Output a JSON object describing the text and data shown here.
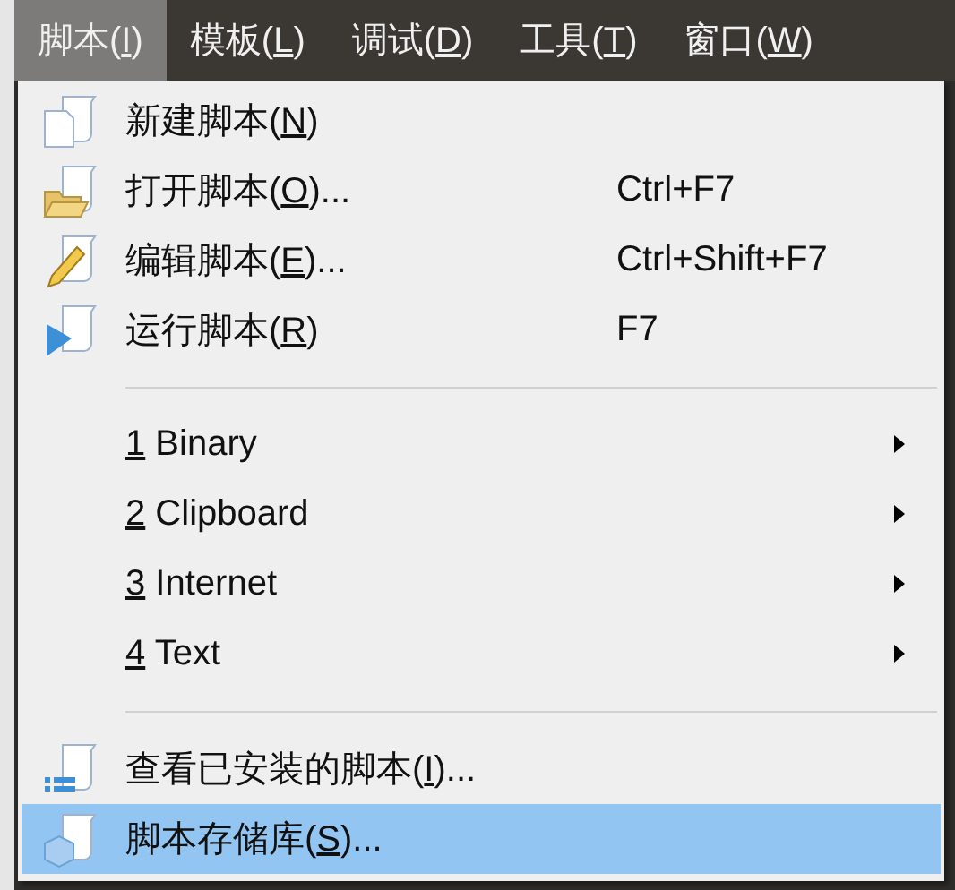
{
  "menubar": [
    {
      "before": "脚本(",
      "key": "I",
      "after": ")",
      "selected": true
    },
    {
      "before": "模板(",
      "key": "L",
      "after": ")",
      "selected": false
    },
    {
      "before": "调试(",
      "key": "D",
      "after": ")",
      "selected": false
    },
    {
      "before": "工具(",
      "key": "T",
      "after": ")",
      "selected": false
    },
    {
      "before": "窗口(",
      "key": "W",
      "after": ")",
      "selected": false
    }
  ],
  "menu": [
    {
      "kind": "command",
      "before": "新建脚本(",
      "key": "N",
      "after": ")",
      "selected": false
    },
    {
      "kind": "command",
      "before": "打开脚本(",
      "key": "O",
      "after": ")...",
      "shortcut": "Ctrl+F7",
      "selected": false
    },
    {
      "kind": "command",
      "before": "编辑脚本(",
      "key": "E",
      "after": ")...",
      "shortcut": "Ctrl+Shift+F7",
      "selected": false
    },
    {
      "kind": "command",
      "before": "运行脚本(",
      "key": "R",
      "after": ")",
      "shortcut": "F7",
      "selected": false
    },
    {
      "kind": "separator"
    },
    {
      "kind": "submenu",
      "key": "1",
      "after": " Binary",
      "selected": false
    },
    {
      "kind": "submenu",
      "key": "2",
      "after": " Clipboard",
      "selected": false
    },
    {
      "kind": "submenu",
      "key": "3",
      "after": " Internet",
      "selected": false
    },
    {
      "kind": "submenu",
      "key": "4",
      "after": " Text",
      "selected": false
    },
    {
      "kind": "separator"
    },
    {
      "kind": "command",
      "before": "查看已安装的脚本(",
      "key": "I",
      "after": ")...",
      "selected": false
    },
    {
      "kind": "command",
      "before": "脚本存储库(",
      "key": "S",
      "after": ")...",
      "selected": true
    }
  ]
}
